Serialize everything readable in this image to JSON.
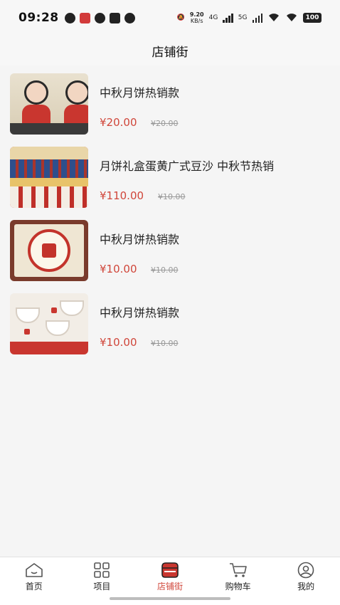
{
  "status_bar": {
    "time": "09:28",
    "speed_value": "9.20",
    "speed_unit": "KB/s",
    "network_1": "4G",
    "network_2": "5G",
    "battery": "100"
  },
  "header": {
    "title": "店铺街"
  },
  "products": [
    {
      "name": "中秋月饼热销款",
      "price": "¥20.00",
      "original_price": "¥20.00"
    },
    {
      "name": "月饼礼盒蛋黄广式豆沙 中秋节热销",
      "price": "¥110.00",
      "original_price": "¥10.00"
    },
    {
      "name": "中秋月饼热销款",
      "price": "¥10.00",
      "original_price": "¥10.00"
    },
    {
      "name": "中秋月饼热销款",
      "price": "¥10.00",
      "original_price": "¥10.00"
    }
  ],
  "tabbar": {
    "items": [
      {
        "label": "首页",
        "icon": "home-icon"
      },
      {
        "label": "项目",
        "icon": "grid-icon"
      },
      {
        "label": "店铺街",
        "icon": "store-icon"
      },
      {
        "label": "购物车",
        "icon": "cart-icon"
      },
      {
        "label": "我的",
        "icon": "user-icon"
      }
    ],
    "active_index": 2,
    "active_color": "#d0463a"
  }
}
